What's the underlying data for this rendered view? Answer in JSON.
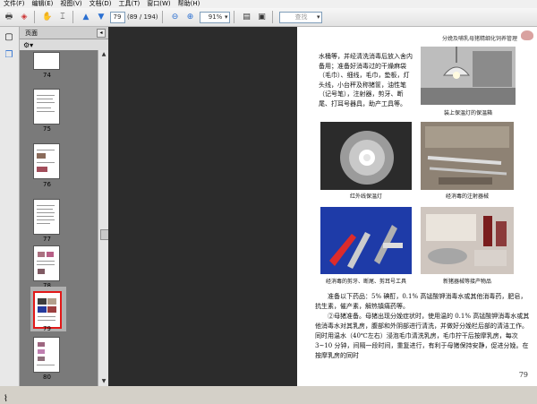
{
  "menu": [
    "文件(F)",
    "编辑(E)",
    "视图(V)",
    "文档(D)",
    "工具(T)",
    "窗口(W)",
    "帮助(H)"
  ],
  "toolbar": {
    "page_current": "79",
    "page_total": "(89 / 194)",
    "zoom": "91%",
    "find_placeholder": "查找"
  },
  "panel": {
    "title": "页面",
    "thumbnails": [
      {
        "label": "74"
      },
      {
        "label": "75"
      },
      {
        "label": "76"
      },
      {
        "label": "77"
      },
      {
        "label": "78"
      },
      {
        "label": "79"
      },
      {
        "label": "80"
      }
    ]
  },
  "document": {
    "header": "分娩及哺乳母猪精细化饲养管理",
    "intro_text": "水桶等，并经清洗消毒后放入舍内备用；准备好消毒过的干燥麻袋（毛巾）、细线，毛巾，垫板，灯头线，小台秤及称猪筐，油性笔（记号笔），注射器，剪牙、断尾、打耳号器具，助产工具等。",
    "captions": {
      "lamp": "装上保温灯的保温箱",
      "infrared": "红外线保温灯",
      "syringe": "经消毒的注射器械",
      "tools": "经消毒的剪牙、断尾、剪耳号工具",
      "medicine": "新猪器械等接产物品"
    },
    "para1": "准备以下药品：5% 碘酊，0.1% 高锰酸钾消毒水或其他消毒药，肥皂，抗生素，催产素，解热镇痛药等。",
    "para2": "②母猪准备。母猪出现分娩症状时，使用温的 0.1% 高锰酸钾消毒水或其他消毒水对其乳房，腹部和外阴部进行清洗，并做好分娩栏后部的清洁工作。同时用温水（40℃左右）浸泡毛巾清洗乳房，毛巾拧干后按摩乳房，每次 3~10 分钟，间隔一段时间，重复进行，有利于母猪保持安静，促进分娩。在按摩乳房的同时",
    "page_number": "79"
  }
}
